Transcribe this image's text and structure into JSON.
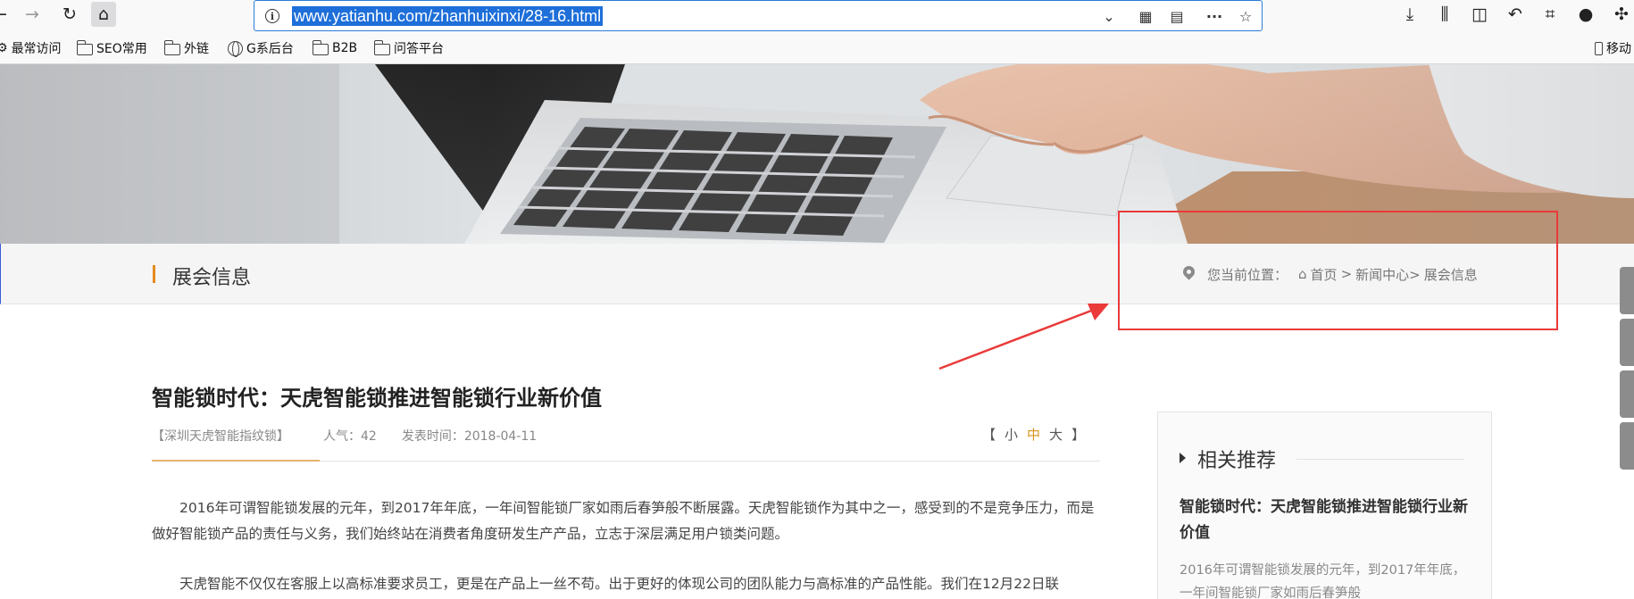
{
  "browser": {
    "url": "www.yatianhu.com/zhanhuixinxi/28-16.html",
    "bookmarks": [
      "最常访问",
      "SEO常用",
      "外链",
      "G系后台",
      "B2B",
      "问答平台"
    ],
    "mobile_bookmarks": "移动"
  },
  "page": {
    "section_title": "展会信息",
    "breadcrumb": {
      "prefix": "您当前位置：",
      "home": "首页",
      "sep": ">",
      "news": "新闻中心>",
      "current": "展会信息"
    },
    "article": {
      "title": "智能锁时代：天虎智能锁推进智能锁行业新价值",
      "source": "【深圳天虎智能指纹锁】",
      "views_label": "人气：42",
      "date_label": "发表时间：2018-04-11",
      "font_size": {
        "open": "【",
        "small": "小",
        "medium": "中",
        "large": "大",
        "close": "】"
      },
      "paragraphs": [
        "2016年可谓智能锁发展的元年，到2017年年底，一年间智能锁厂家如雨后春笋般不断展露。天虎智能锁作为其中之一，感受到的不是竞争压力，而是做好智能锁产品的责任与义务，我们始终站在消费者角度研发生产产品，立志于深层满足用户锁类问题。",
        "天虎智能不仅仅在客服上以高标准要求员工，更是在产品上一丝不苟。出于更好的体现公司的团队能力与高标准的产品性能。我们在12月22日联"
      ]
    },
    "sidebar": {
      "title": "相关推荐",
      "item_title": "智能锁时代：天虎智能锁推进智能锁行业新价值",
      "item_desc": "2016年可谓智能锁发展的元年，到2017年年底，一年间智能锁厂家如雨后春笋般"
    }
  },
  "colors": {
    "accent": "#e48a1e",
    "annotation": "#ea3a3a",
    "url_highlight": "#1e6fd9"
  }
}
